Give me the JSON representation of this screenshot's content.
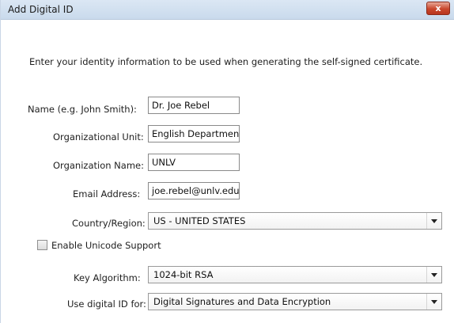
{
  "window": {
    "title": "Add Digital ID",
    "close_label": "x"
  },
  "intro_text": "Enter your identity information to be used when generating the self-signed certificate.",
  "fields": {
    "name": {
      "label": "Name (e.g. John Smith):",
      "value": "Dr. Joe Rebel"
    },
    "org_unit": {
      "label": "Organizational Unit:",
      "value": "English Department"
    },
    "org_name": {
      "label": "Organization Name:",
      "value": "UNLV"
    },
    "email": {
      "label": "Email Address:",
      "value": "joe.rebel@unlv.edu"
    },
    "country": {
      "label": "Country/Region:",
      "value": "US - UNITED STATES"
    },
    "unicode": {
      "label": "Enable Unicode Support",
      "checked": false
    },
    "key_algorithm": {
      "label": "Key Algorithm:",
      "value": "1024-bit RSA"
    },
    "usage": {
      "label": "Use digital ID for:",
      "value": "Digital Signatures and Data Encryption"
    }
  },
  "icons": {
    "close": "close-icon",
    "dropdown": "chevron-down-icon"
  },
  "colors": {
    "titlebar": "#c9daec",
    "close_button": "#c9472d",
    "field_border": "#8a8a8a"
  }
}
